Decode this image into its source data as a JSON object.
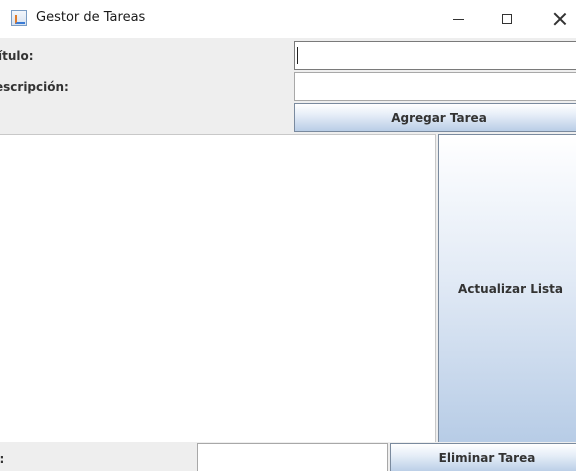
{
  "window": {
    "title": "Gestor de Tareas",
    "icon": "java-app-icon",
    "controls": [
      "minimize",
      "maximize",
      "close"
    ]
  },
  "form": {
    "titulo_label": "ítulo:",
    "titulo_value": "",
    "descripcion_label": "escripción:",
    "descripcion_value": "",
    "agregar_button": "Agregar Tarea"
  },
  "task_list": {
    "items": []
  },
  "actions": {
    "actualizar_button": "Actualizar Lista",
    "id_label": "):",
    "id_value": "",
    "eliminar_button": "Eliminar Tarea"
  }
}
